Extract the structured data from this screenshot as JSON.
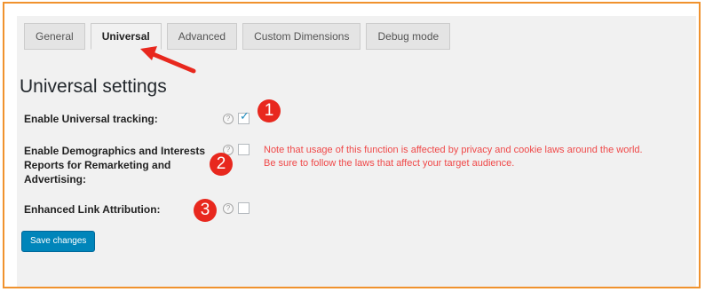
{
  "tabs": [
    {
      "label": "General",
      "active": false
    },
    {
      "label": "Universal",
      "active": true
    },
    {
      "label": "Advanced",
      "active": false
    },
    {
      "label": "Custom Dimensions",
      "active": false
    },
    {
      "label": "Debug mode",
      "active": false
    }
  ],
  "heading": "Universal settings",
  "settings": [
    {
      "label": "Enable Universal tracking:",
      "checked": true,
      "help": "?"
    },
    {
      "label": "Enable Demographics and Interests Reports for Remarketing and Advertising:",
      "checked": false,
      "help": "?"
    },
    {
      "label": "Enhanced Link Attribution:",
      "checked": false,
      "help": "?"
    }
  ],
  "note": {
    "line1": "Note that usage of this function is affected by privacy and cookie laws around the world.",
    "line2": "Be sure to follow the laws that affect your target audience."
  },
  "save_button": "Save changes",
  "check_mark": "✓",
  "annotations": {
    "badges": [
      "1",
      "2",
      "3"
    ]
  },
  "colors": {
    "frame_border": "#f0922e",
    "accent_blue": "#0085ba",
    "annotation_red": "#e8281e",
    "note_red": "#f04848"
  }
}
